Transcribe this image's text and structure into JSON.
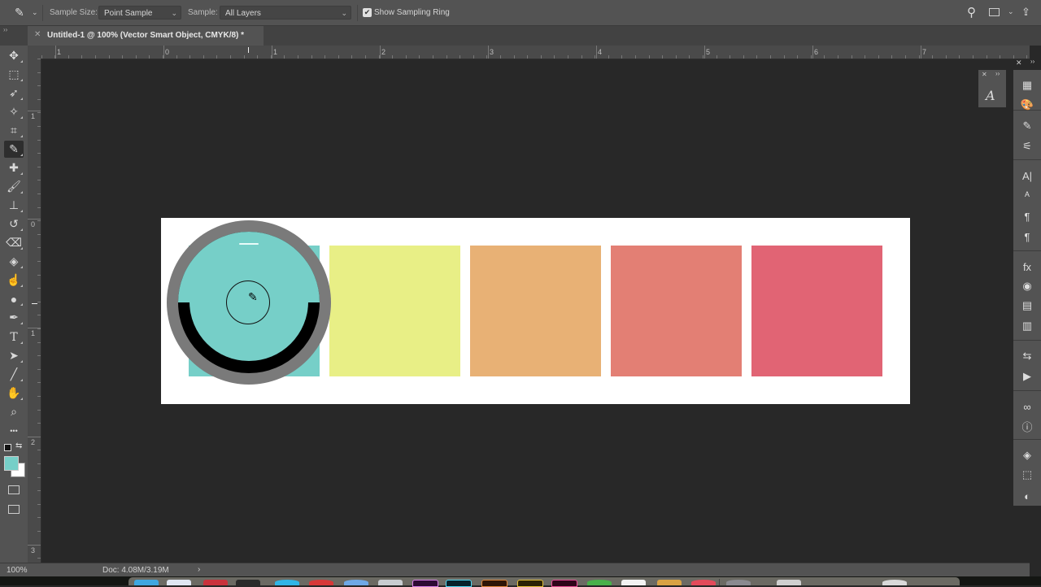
{
  "options_bar": {
    "tool_icon": "eyedropper-icon",
    "sample_size_label": "Sample Size:",
    "sample_size_value": "Point Sample",
    "sample_label": "Sample:",
    "sample_value": "All Layers",
    "show_sampling_ring_label": "Show Sampling Ring",
    "show_sampling_ring_checked": true,
    "right_icons": [
      "search-icon",
      "workspace-icon",
      "share-icon"
    ]
  },
  "document_tab": {
    "title": "Untitled-1 @ 100% (Vector Smart Object, CMYK/8) *"
  },
  "toolbar": {
    "tools": [
      {
        "name": "move",
        "glyph": "✥"
      },
      {
        "name": "rectangular-marquee",
        "glyph": "⬚"
      },
      {
        "name": "lasso",
        "glyph": "➶"
      },
      {
        "name": "magic-wand",
        "glyph": "✧"
      },
      {
        "name": "crop",
        "glyph": "⌗"
      },
      {
        "name": "eyedropper",
        "glyph": "✎",
        "active": true
      },
      {
        "name": "healing-brush",
        "glyph": "✚"
      },
      {
        "name": "brush",
        "glyph": "🖌"
      },
      {
        "name": "clone-stamp",
        "glyph": "⊥"
      },
      {
        "name": "history-brush",
        "glyph": "↺"
      },
      {
        "name": "eraser",
        "glyph": "⌫"
      },
      {
        "name": "paint-bucket",
        "glyph": "◈"
      },
      {
        "name": "smudge",
        "glyph": "☝"
      },
      {
        "name": "dodge",
        "glyph": "●"
      },
      {
        "name": "pen",
        "glyph": "✒"
      },
      {
        "name": "type",
        "glyph": "T"
      },
      {
        "name": "path-selection",
        "glyph": "➤"
      },
      {
        "name": "line",
        "glyph": "╱"
      },
      {
        "name": "hand",
        "glyph": "✋"
      },
      {
        "name": "zoom",
        "glyph": "⌕"
      },
      {
        "name": "more-tools",
        "glyph": "•••"
      }
    ],
    "foreground_color": "#76cfc8",
    "background_color": "#ffffff"
  },
  "rulers": {
    "horizontal": [
      "1",
      "0",
      "1",
      "2",
      "3",
      "4",
      "5",
      "6",
      "7"
    ],
    "vertical": [
      "1",
      "0",
      "1",
      "2",
      "3"
    ]
  },
  "canvas": {
    "swatches": [
      {
        "name": "teal",
        "color": "#76cfc8"
      },
      {
        "name": "yellow",
        "color": "#e8ef86"
      },
      {
        "name": "orange",
        "color": "#e8b175"
      },
      {
        "name": "salmon",
        "color": "#e37f74"
      },
      {
        "name": "pink-red",
        "color": "#e16474"
      }
    ],
    "sampled_color": "#76cfc8"
  },
  "right_panel": {
    "icons": [
      "libraries-grid-icon",
      "color-palette-icon",
      "brush-settings-icon",
      "adjustments-icon",
      "character-icon",
      "character-styles-icon",
      "paragraph-icon",
      "paragraph-styles-icon",
      "styles-fx-icon",
      "channels-icon",
      "properties-icon",
      "notes-icon",
      "history-icon",
      "actions-play-icon",
      "creative-cloud-icon",
      "info-icon",
      "layers-icon",
      "3d-icon",
      "adjustments-circle-icon"
    ],
    "float_panel_icon": "glyphs-icon"
  },
  "status_bar": {
    "zoom": "100%",
    "doc_size": "Doc: 4.08M/3.19M",
    "arrow": "›"
  }
}
